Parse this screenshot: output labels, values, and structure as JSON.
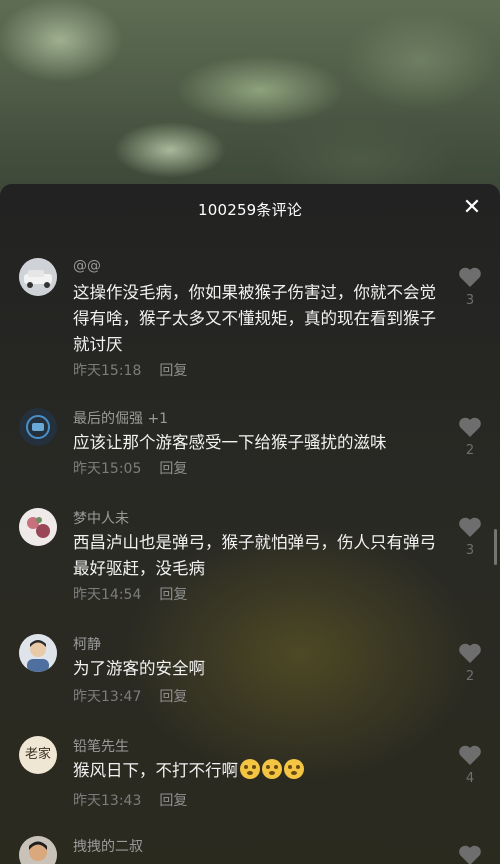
{
  "header": {
    "title": "100259条评论"
  },
  "comments": [
    {
      "name": "@@",
      "text": "这操作没毛病，你如果被猴子伤害过，你就不会觉得有啥，猴子太多又不懂规矩，真的现在看到猴子就讨厌",
      "time": "昨天15:18",
      "reply": "回复",
      "likes": "3"
    },
    {
      "name": "最后的倔强 +1",
      "text": "应该让那个游客感受一下给猴子骚扰的滋味",
      "time": "昨天15:05",
      "reply": "回复",
      "likes": "2"
    },
    {
      "name": "梦中人未",
      "text": "西昌泸山也是弹弓，猴子就怕弹弓，伤人只有弹弓最好驱赶，没毛病",
      "time": "昨天14:54",
      "reply": "回复",
      "likes": "3"
    },
    {
      "name": "柯静",
      "text": "为了游客的安全啊",
      "time": "昨天13:47",
      "reply": "回复",
      "likes": "2"
    },
    {
      "name": "铅笔先生",
      "text": "猴风日下，不打不行啊",
      "time": "昨天13:43",
      "reply": "回复",
      "likes": "4"
    },
    {
      "name": "拽拽的二叔",
      "text": "",
      "time": "",
      "reply": "",
      "likes": ""
    }
  ],
  "avatar5_text": "老家",
  "colors": {
    "accent_like": "#6e6e6e",
    "sheet_bg": "#222222"
  },
  "icons": {
    "close": "close-icon",
    "like": "heart-icon"
  }
}
